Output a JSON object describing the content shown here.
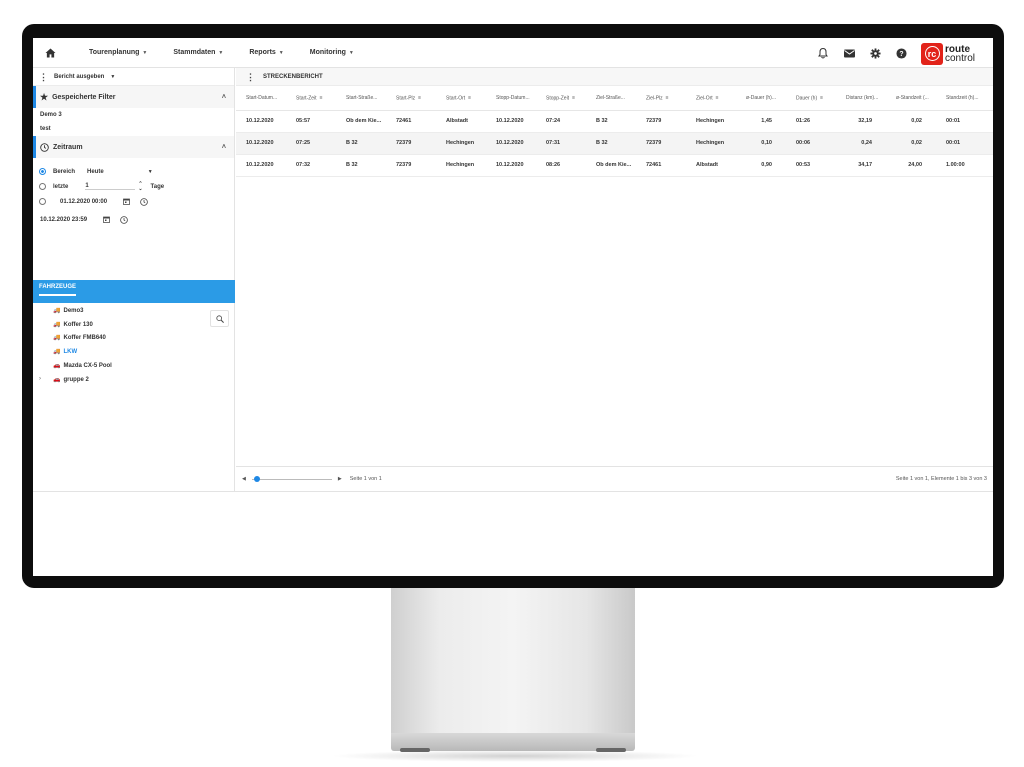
{
  "nav": {
    "items": [
      {
        "label": "Tourenplanung"
      },
      {
        "label": "Stammdaten"
      },
      {
        "label": "Reports"
      },
      {
        "label": "Monitoring"
      }
    ],
    "logo": {
      "top": "route",
      "bottom": "control",
      "badge": "rc"
    }
  },
  "left": {
    "header_label": "Bericht ausgeben",
    "saved_filter_title": "Gespeicherte Filter",
    "saved_filters": [
      "Demo 3",
      "test"
    ],
    "zeitraum_title": "Zeitraum",
    "bereich_label": "Bereich",
    "bereich_value": "Heute",
    "letzte_label": "letzte",
    "letzte_value": "1",
    "tage_label": "Tage",
    "from_datetime": "01.12.2020 00:00",
    "to_datetime": "10.12.2020 23:59",
    "fahrzeuge_tab": "FAHRZEUGE",
    "vehicles": [
      "Demo3",
      "Koffer 130",
      "Koffer FMB640",
      "LKW",
      "Mazda CX-5 Pool",
      "gruppe 2"
    ]
  },
  "main": {
    "title": "STRECKENBERICHT",
    "columns": [
      "Start-Datum...",
      "Start-Zeit",
      "Start-Straße...",
      "Start-Plz",
      "Start-Ort",
      "Stopp-Datum...",
      "Stopp-Zeit",
      "Ziel-Straße...",
      "Ziel-Plz",
      "Ziel-Ort",
      "ø-Dauer (h)...",
      "Dauer (h)",
      "Distanz (km)...",
      "ø-Standzeit (...",
      "Standzeit (h)..."
    ],
    "rows": [
      [
        "10.12.2020",
        "05:57",
        "Ob dem Kie...",
        "72461",
        "Albstadt",
        "10.12.2020",
        "07:24",
        "B 32",
        "72379",
        "Hechingen",
        "1,45",
        "01:26",
        "32,19",
        "0,02",
        "00:01"
      ],
      [
        "10.12.2020",
        "07:25",
        "B 32",
        "72379",
        "Hechingen",
        "10.12.2020",
        "07:31",
        "B 32",
        "72379",
        "Hechingen",
        "0,10",
        "00:06",
        "0,24",
        "0,02",
        "00:01"
      ],
      [
        "10.12.2020",
        "07:32",
        "B 32",
        "72379",
        "Hechingen",
        "10.12.2020",
        "08:26",
        "Ob dem Kie...",
        "72461",
        "Albstadt",
        "0,90",
        "00:53",
        "34,17",
        "24,00",
        "1.00:00"
      ]
    ],
    "pager_left": "Seite 1 von 1",
    "pager_right": "Seite 1 von 1, Elemente 1 bis 3 von 3"
  },
  "colors": {
    "accent": "#2b9be6",
    "brand": "#e2231a"
  }
}
